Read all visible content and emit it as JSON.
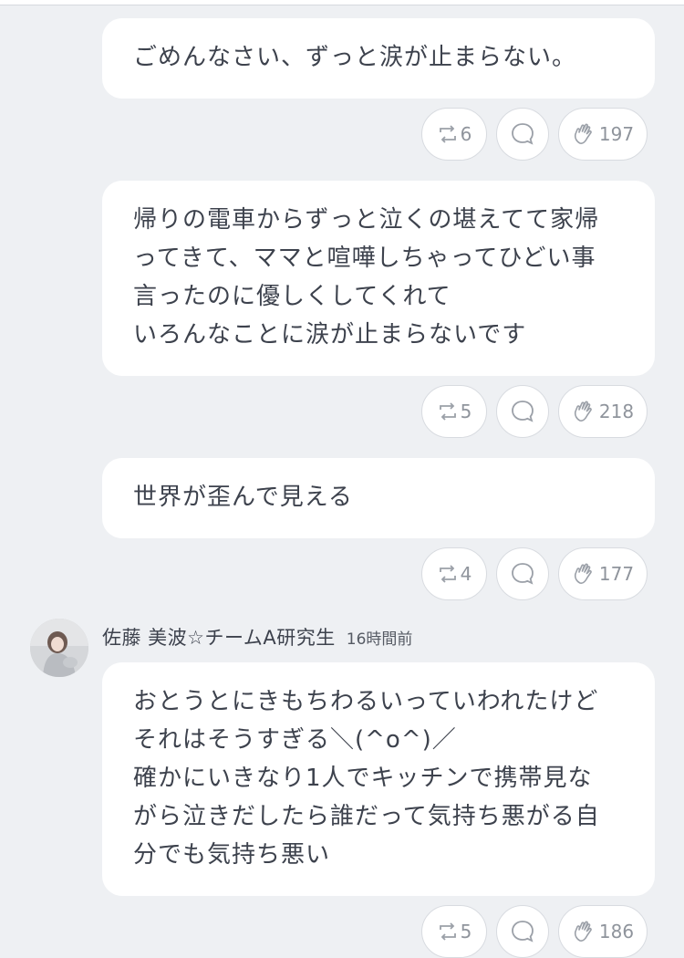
{
  "posts": [
    {
      "lines": [
        "ごめんなさい、ずっと涙が止まらない。"
      ],
      "retweets": "6",
      "claps": "197"
    },
    {
      "lines": [
        "帰りの電車からずっと泣くの堪えてて家帰",
        "ってきて、ママと喧嘩しちゃってひどい事",
        "言ったのに優しくしてくれて",
        "いろんなことに涙が止まらないです"
      ],
      "retweets": "5",
      "claps": "218"
    },
    {
      "lines": [
        "世界が歪んで見える"
      ],
      "retweets": "4",
      "claps": "177"
    },
    {
      "author": "佐藤 美波☆チームA研究生",
      "time": "16時間前",
      "lines": [
        "おとうとにきもちわるいっていわれたけど",
        "それはそうすぎる＼(^o^)／",
        "確かにいきなり1人でキッチンで携帯見な",
        "がら泣きだしたら誰だって気持ち悪がる自",
        "分でも気持ち悪い"
      ],
      "retweets": "5",
      "claps": "186"
    }
  ],
  "icons": {
    "retweet": "retweet-icon",
    "reply": "reply-icon",
    "clap": "clap-icon"
  },
  "colors": {
    "background": "#eef0f3",
    "bubble": "#ffffff",
    "icon": "#8f949c"
  }
}
